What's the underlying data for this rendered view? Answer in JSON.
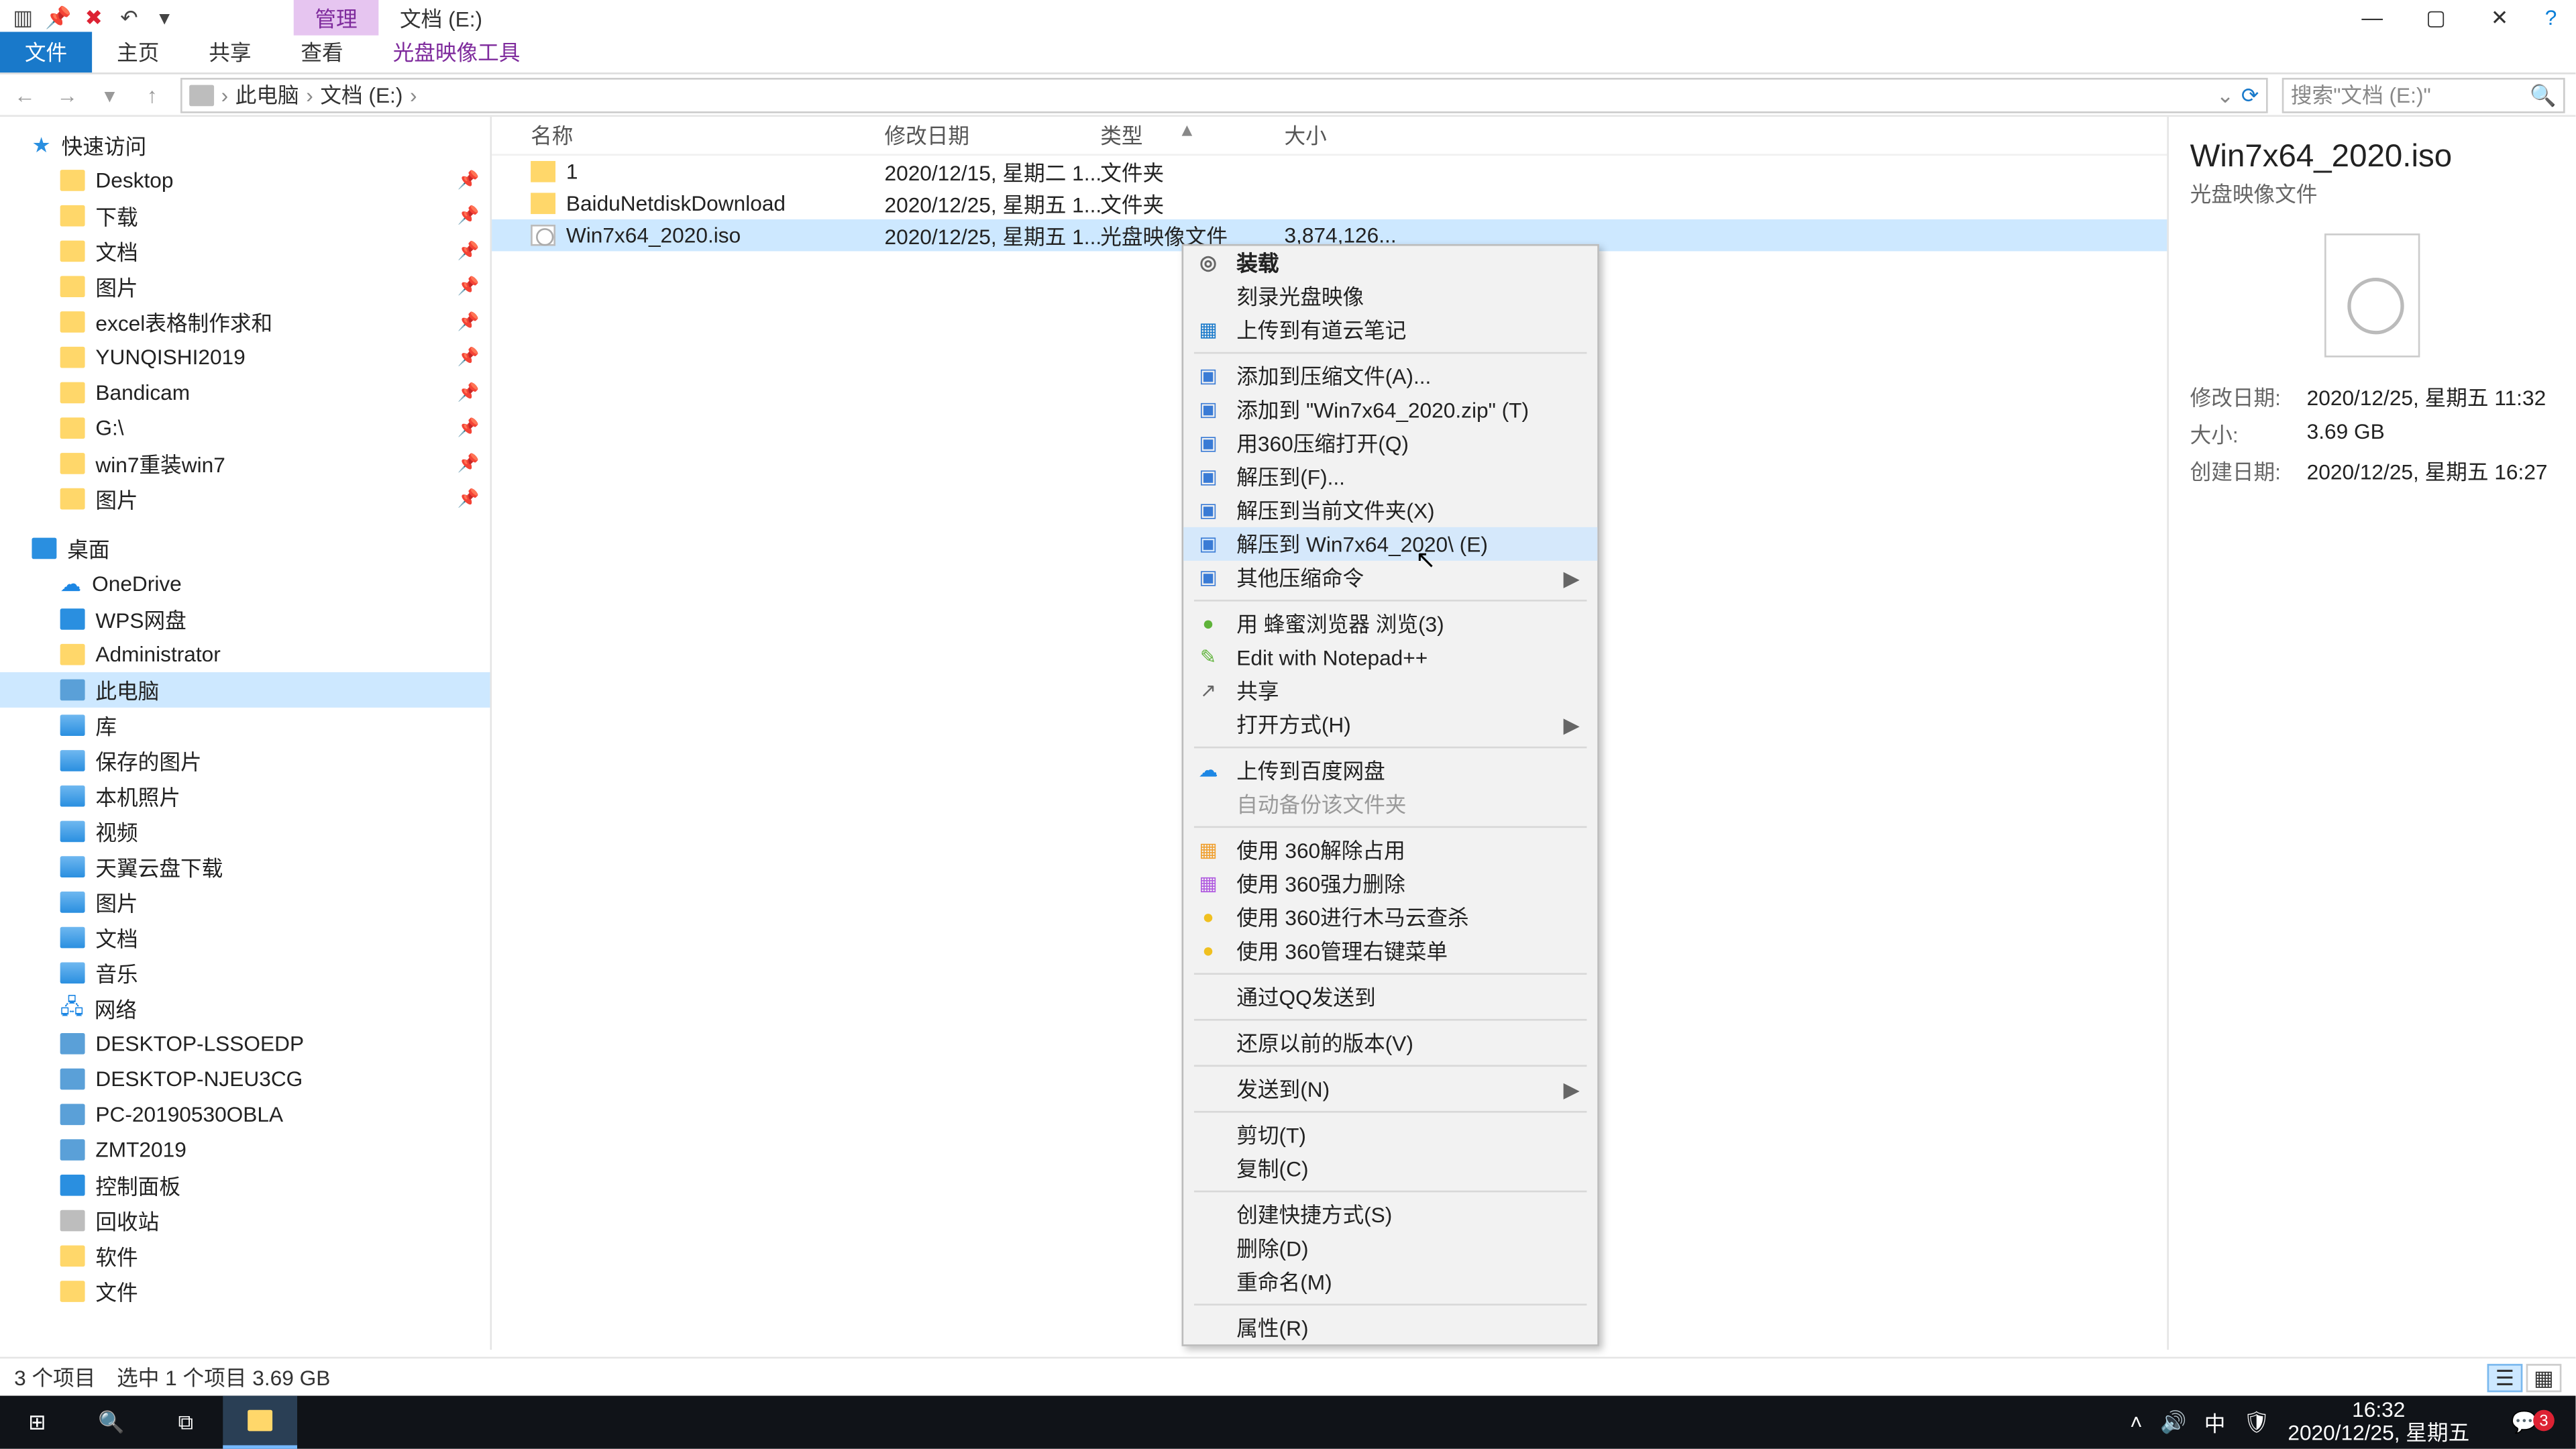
{
  "title_bar": {
    "ribbon_context": "管理",
    "window_title": "文档 (E:)"
  },
  "ribbon_tabs": {
    "file": "文件",
    "home": "主页",
    "share": "共享",
    "view": "查看",
    "tool": "光盘映像工具"
  },
  "address": {
    "root": "此电脑",
    "current": "文档 (E:)",
    "search_placeholder": "搜索\"文档 (E:)\""
  },
  "nav_tree": {
    "quick": "快速访问",
    "items_quick": [
      "Desktop",
      "下载",
      "文档",
      "图片",
      "excel表格制作求和",
      "YUNQISHI2019",
      "Bandicam",
      "G:\\",
      "win7重装win7",
      "图片"
    ],
    "desktop": "桌面",
    "items_desktop": [
      "OneDrive",
      "WPS网盘",
      "Administrator",
      "此电脑",
      "库"
    ],
    "libs": [
      "保存的图片",
      "本机照片",
      "视频",
      "天翼云盘下载",
      "图片",
      "文档",
      "音乐"
    ],
    "network": "网络",
    "net_items": [
      "DESKTOP-LSSOEDP",
      "DESKTOP-NJEU3CG",
      "PC-20190530OBLA",
      "ZMT2019"
    ],
    "extras": [
      "控制面板",
      "回收站",
      "软件",
      "文件"
    ]
  },
  "columns": {
    "name": "名称",
    "date": "修改日期",
    "type": "类型",
    "size": "大小"
  },
  "files": [
    {
      "name": "1",
      "date": "2020/12/15, 星期二 1...",
      "type": "文件夹",
      "size": ""
    },
    {
      "name": "BaiduNetdiskDownload",
      "date": "2020/12/25, 星期五 1...",
      "type": "文件夹",
      "size": ""
    },
    {
      "name": "Win7x64_2020.iso",
      "date": "2020/12/25, 星期五 1...",
      "type": "光盘映像文件",
      "size": "3,874,126..."
    }
  ],
  "context_menu": {
    "groups": [
      [
        {
          "t": "装载",
          "b": true,
          "i": "◎"
        },
        {
          "t": "刻录光盘映像"
        },
        {
          "t": "上传到有道云笔记",
          "i": "▦",
          "c": "#1979ca"
        }
      ],
      [
        {
          "t": "添加到压缩文件(A)...",
          "i": "▣",
          "c": "#3a7bd5"
        },
        {
          "t": "添加到 \"Win7x64_2020.zip\" (T)",
          "i": "▣",
          "c": "#3a7bd5"
        },
        {
          "t": "用360压缩打开(Q)",
          "i": "▣",
          "c": "#3a7bd5"
        },
        {
          "t": "解压到(F)...",
          "i": "▣",
          "c": "#3a7bd5"
        },
        {
          "t": "解压到当前文件夹(X)",
          "i": "▣",
          "c": "#3a7bd5"
        },
        {
          "t": "解压到 Win7x64_2020\\ (E)",
          "i": "▣",
          "c": "#3a7bd5",
          "hov": true
        },
        {
          "t": "其他压缩命令",
          "i": "▣",
          "c": "#3a7bd5",
          "sub": true
        }
      ],
      [
        {
          "t": "用 蜂蜜浏览器 浏览(3)",
          "i": "●",
          "c": "#5fb33a"
        },
        {
          "t": "Edit with Notepad++",
          "i": "✎",
          "c": "#5fb33a"
        },
        {
          "t": "共享",
          "i": "↗"
        },
        {
          "t": "打开方式(H)",
          "sub": true
        }
      ],
      [
        {
          "t": "上传到百度网盘",
          "i": "☁",
          "c": "#1d87e4"
        },
        {
          "t": "自动备份该文件夹",
          "dis": true
        }
      ],
      [
        {
          "t": "使用 360解除占用",
          "i": "▦",
          "c": "#f0a030"
        },
        {
          "t": "使用 360强力删除",
          "i": "▦",
          "c": "#b05ae0"
        },
        {
          "t": "使用 360进行木马云查杀",
          "i": "●",
          "c": "#f0c020"
        },
        {
          "t": "使用 360管理右键菜单",
          "i": "●",
          "c": "#f0c020"
        }
      ],
      [
        {
          "t": "通过QQ发送到"
        }
      ],
      [
        {
          "t": "还原以前的版本(V)"
        }
      ],
      [
        {
          "t": "发送到(N)",
          "sub": true
        }
      ],
      [
        {
          "t": "剪切(T)"
        },
        {
          "t": "复制(C)"
        }
      ],
      [
        {
          "t": "创建快捷方式(S)"
        },
        {
          "t": "删除(D)"
        },
        {
          "t": "重命名(M)"
        }
      ],
      [
        {
          "t": "属性(R)"
        }
      ]
    ]
  },
  "details": {
    "title": "Win7x64_2020.iso",
    "subtitle": "光盘映像文件",
    "rows": [
      {
        "label": "修改日期:",
        "value": "2020/12/25, 星期五 11:32"
      },
      {
        "label": "大小:",
        "value": "3.69 GB"
      },
      {
        "label": "创建日期:",
        "value": "2020/12/25, 星期五 16:27"
      }
    ]
  },
  "status": {
    "count": "3 个项目",
    "sel": "选中 1 个项目  3.69 GB"
  },
  "taskbar": {
    "time": "16:32",
    "date": "2020/12/25, 星期五",
    "ime": "中",
    "badge": "3"
  }
}
